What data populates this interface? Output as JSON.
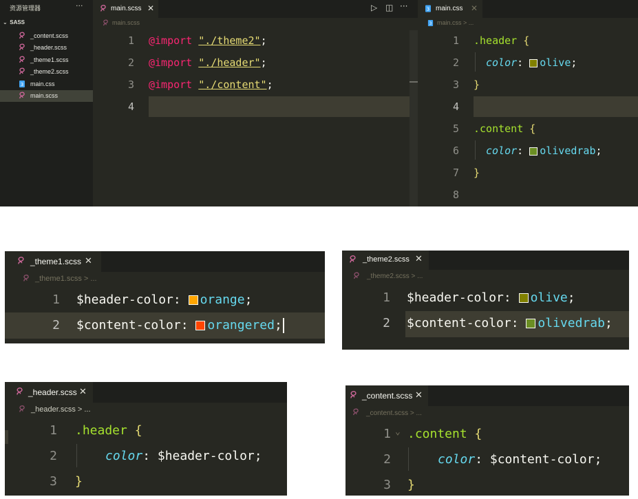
{
  "sidebar": {
    "title": "资源管理器",
    "more": "···",
    "folder": "SASS",
    "files": [
      {
        "name": "_content.scss",
        "type": "scss"
      },
      {
        "name": "_header.scss",
        "type": "scss"
      },
      {
        "name": "_theme1.scss",
        "type": "scss"
      },
      {
        "name": "_theme2.scss",
        "type": "scss"
      },
      {
        "name": "main.css",
        "type": "css"
      },
      {
        "name": "main.scss",
        "type": "scss",
        "selected": true
      }
    ]
  },
  "left_editor": {
    "tab": "main.scss",
    "close": "✕",
    "breadcrumb": "main.scss",
    "actions": {
      "run": "▷",
      "split": "◫",
      "more": "···"
    },
    "line_numbers": [
      "1",
      "2",
      "3",
      "4"
    ],
    "lines": [
      {
        "kw": "@import",
        "str": "\"./theme2\"",
        "end": ";"
      },
      {
        "kw": "@import",
        "str": "\"./header\"",
        "end": ";"
      },
      {
        "kw": "@import",
        "str": "\"./content\"",
        "end": ";"
      }
    ]
  },
  "right_editor": {
    "tab": "main.css",
    "close": "✕",
    "breadcrumb": "main.css > ...",
    "line_numbers": [
      "1",
      "2",
      "3",
      "4",
      "5",
      "6",
      "7",
      "8"
    ],
    "header_selector": ".header",
    "content_selector": ".content",
    "open_brace": "{",
    "close_brace": "}",
    "prop": "color",
    "colon": ":",
    "header_value": "olive",
    "content_value": "olivedrab",
    "semicolon": ";"
  },
  "theme1": {
    "tab": "_theme1.scss",
    "close": "✕",
    "breadcrumb": "_theme1.scss > ...",
    "line_numbers": [
      "1",
      "2"
    ],
    "var1": "$header-color",
    "val1": "orange",
    "var2": "$content-color",
    "val2": "orangered",
    "colon": ":",
    "semicolon": ";"
  },
  "theme2": {
    "tab": "_theme2.scss",
    "close": "✕",
    "breadcrumb": "_theme2.scss > ...",
    "line_numbers": [
      "1",
      "2"
    ],
    "var1": "$header-color",
    "val1": "olive",
    "var2": "$content-color",
    "val2": "olivedrab",
    "colon": ":",
    "semicolon": ";"
  },
  "header_file": {
    "tab": "_header.scss",
    "close": "✕",
    "breadcrumb": "_header.scss > ...",
    "line_numbers": [
      "1",
      "2",
      "3"
    ],
    "selector": ".header",
    "open_brace": "{",
    "prop": "color",
    "value": "$header-color",
    "colon": ":",
    "semicolon": ";",
    "close_brace": "}"
  },
  "content_file": {
    "tab": "_content.scss",
    "close": "✕",
    "breadcrumb": "_content.scss > ...",
    "line_numbers": [
      "1",
      "2",
      "3"
    ],
    "fold": "⌄",
    "selector": ".content",
    "open_brace": "{",
    "prop": "color",
    "value": "$content-color",
    "colon": ":",
    "semicolon": ";",
    "close_brace": "}"
  },
  "colors": {
    "editor_bg": "#272822",
    "sidebar_bg": "#1e1f1c",
    "keyword": "#f92672",
    "string": "#e6db74",
    "selector": "#a6e22e",
    "value": "#66d9ef",
    "orange": "#ffa500",
    "orangered": "#ff4500",
    "olive": "#808000",
    "olivedrab": "#6b8e23",
    "sass_icon": "#cd6799",
    "css_icon": "#42a5f5"
  }
}
